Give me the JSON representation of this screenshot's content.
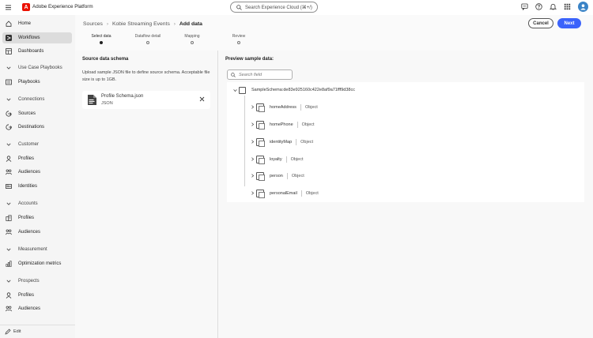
{
  "app": {
    "title": "Adobe Experience Platform",
    "logo_letter": "A",
    "brand_color": "#eb1000"
  },
  "search": {
    "placeholder": "Search Experience Cloud (⌘+/)"
  },
  "top_icons": [
    "chat-icon",
    "help-icon",
    "bell-icon",
    "apps-grid-icon",
    "avatar"
  ],
  "sidebar": {
    "items": [
      {
        "type": "item",
        "label": "Home",
        "icon": "home-icon"
      },
      {
        "type": "item",
        "label": "Workflows",
        "icon": "workflow-icon",
        "active": true
      },
      {
        "type": "item",
        "label": "Dashboards",
        "icon": "dashboard-icon"
      },
      {
        "type": "section",
        "label": "Use Case Playbooks"
      },
      {
        "type": "item",
        "label": "Playbooks",
        "icon": "playbook-icon"
      },
      {
        "type": "section",
        "label": "Connections"
      },
      {
        "type": "item",
        "label": "Sources",
        "icon": "sources-icon"
      },
      {
        "type": "item",
        "label": "Destinations",
        "icon": "destinations-icon"
      },
      {
        "type": "section",
        "label": "Customer"
      },
      {
        "type": "item",
        "label": "Profiles",
        "icon": "profile-icon"
      },
      {
        "type": "item",
        "label": "Audiences",
        "icon": "audiences-icon"
      },
      {
        "type": "item",
        "label": "Identities",
        "icon": "identities-icon"
      },
      {
        "type": "section",
        "label": "Accounts"
      },
      {
        "type": "item",
        "label": "Profiles",
        "icon": "building-icon"
      },
      {
        "type": "item",
        "label": "Audiences",
        "icon": "audiences-icon"
      },
      {
        "type": "section",
        "label": "Measurement"
      },
      {
        "type": "item",
        "label": "Optimization metrics",
        "icon": "metrics-icon"
      },
      {
        "type": "section",
        "label": "Prospects"
      },
      {
        "type": "item",
        "label": "Profiles",
        "icon": "profile-icon"
      },
      {
        "type": "item",
        "label": "Audiences",
        "icon": "audiences-icon"
      }
    ],
    "footer_label": "Edit"
  },
  "breadcrumb": {
    "items": [
      "Sources",
      "Kobie Streaming Events"
    ],
    "current": "Add data"
  },
  "actions": {
    "cancel_label": "Cancel",
    "next_label": "Next",
    "accent_color": "#3b63fb"
  },
  "steps": [
    {
      "label": "Select data",
      "active": true
    },
    {
      "label": "Dataflow detail",
      "active": false
    },
    {
      "label": "Mapping",
      "active": false
    },
    {
      "label": "Review",
      "active": false
    }
  ],
  "source_panel": {
    "title": "Source data schema",
    "description": "Upload sample JSON file to define source schema. Acceptable file size is up to 1GB.",
    "file": {
      "name": "Profile Schema.json",
      "type": "JSON"
    }
  },
  "preview_panel": {
    "title": "Preview sample data:",
    "search_placeholder": "Search field",
    "root_label": "SampleSchema:de83e925160c422e8af9a71fff9d38cc",
    "fields": [
      {
        "name": "homeAddress",
        "type": "Object"
      },
      {
        "name": "homePhone",
        "type": "Object"
      },
      {
        "name": "identityMap",
        "type": "Object"
      },
      {
        "name": "loyalty",
        "type": "Object"
      },
      {
        "name": "person",
        "type": "Object"
      },
      {
        "name": "personalEmail",
        "type": "Object"
      }
    ]
  }
}
